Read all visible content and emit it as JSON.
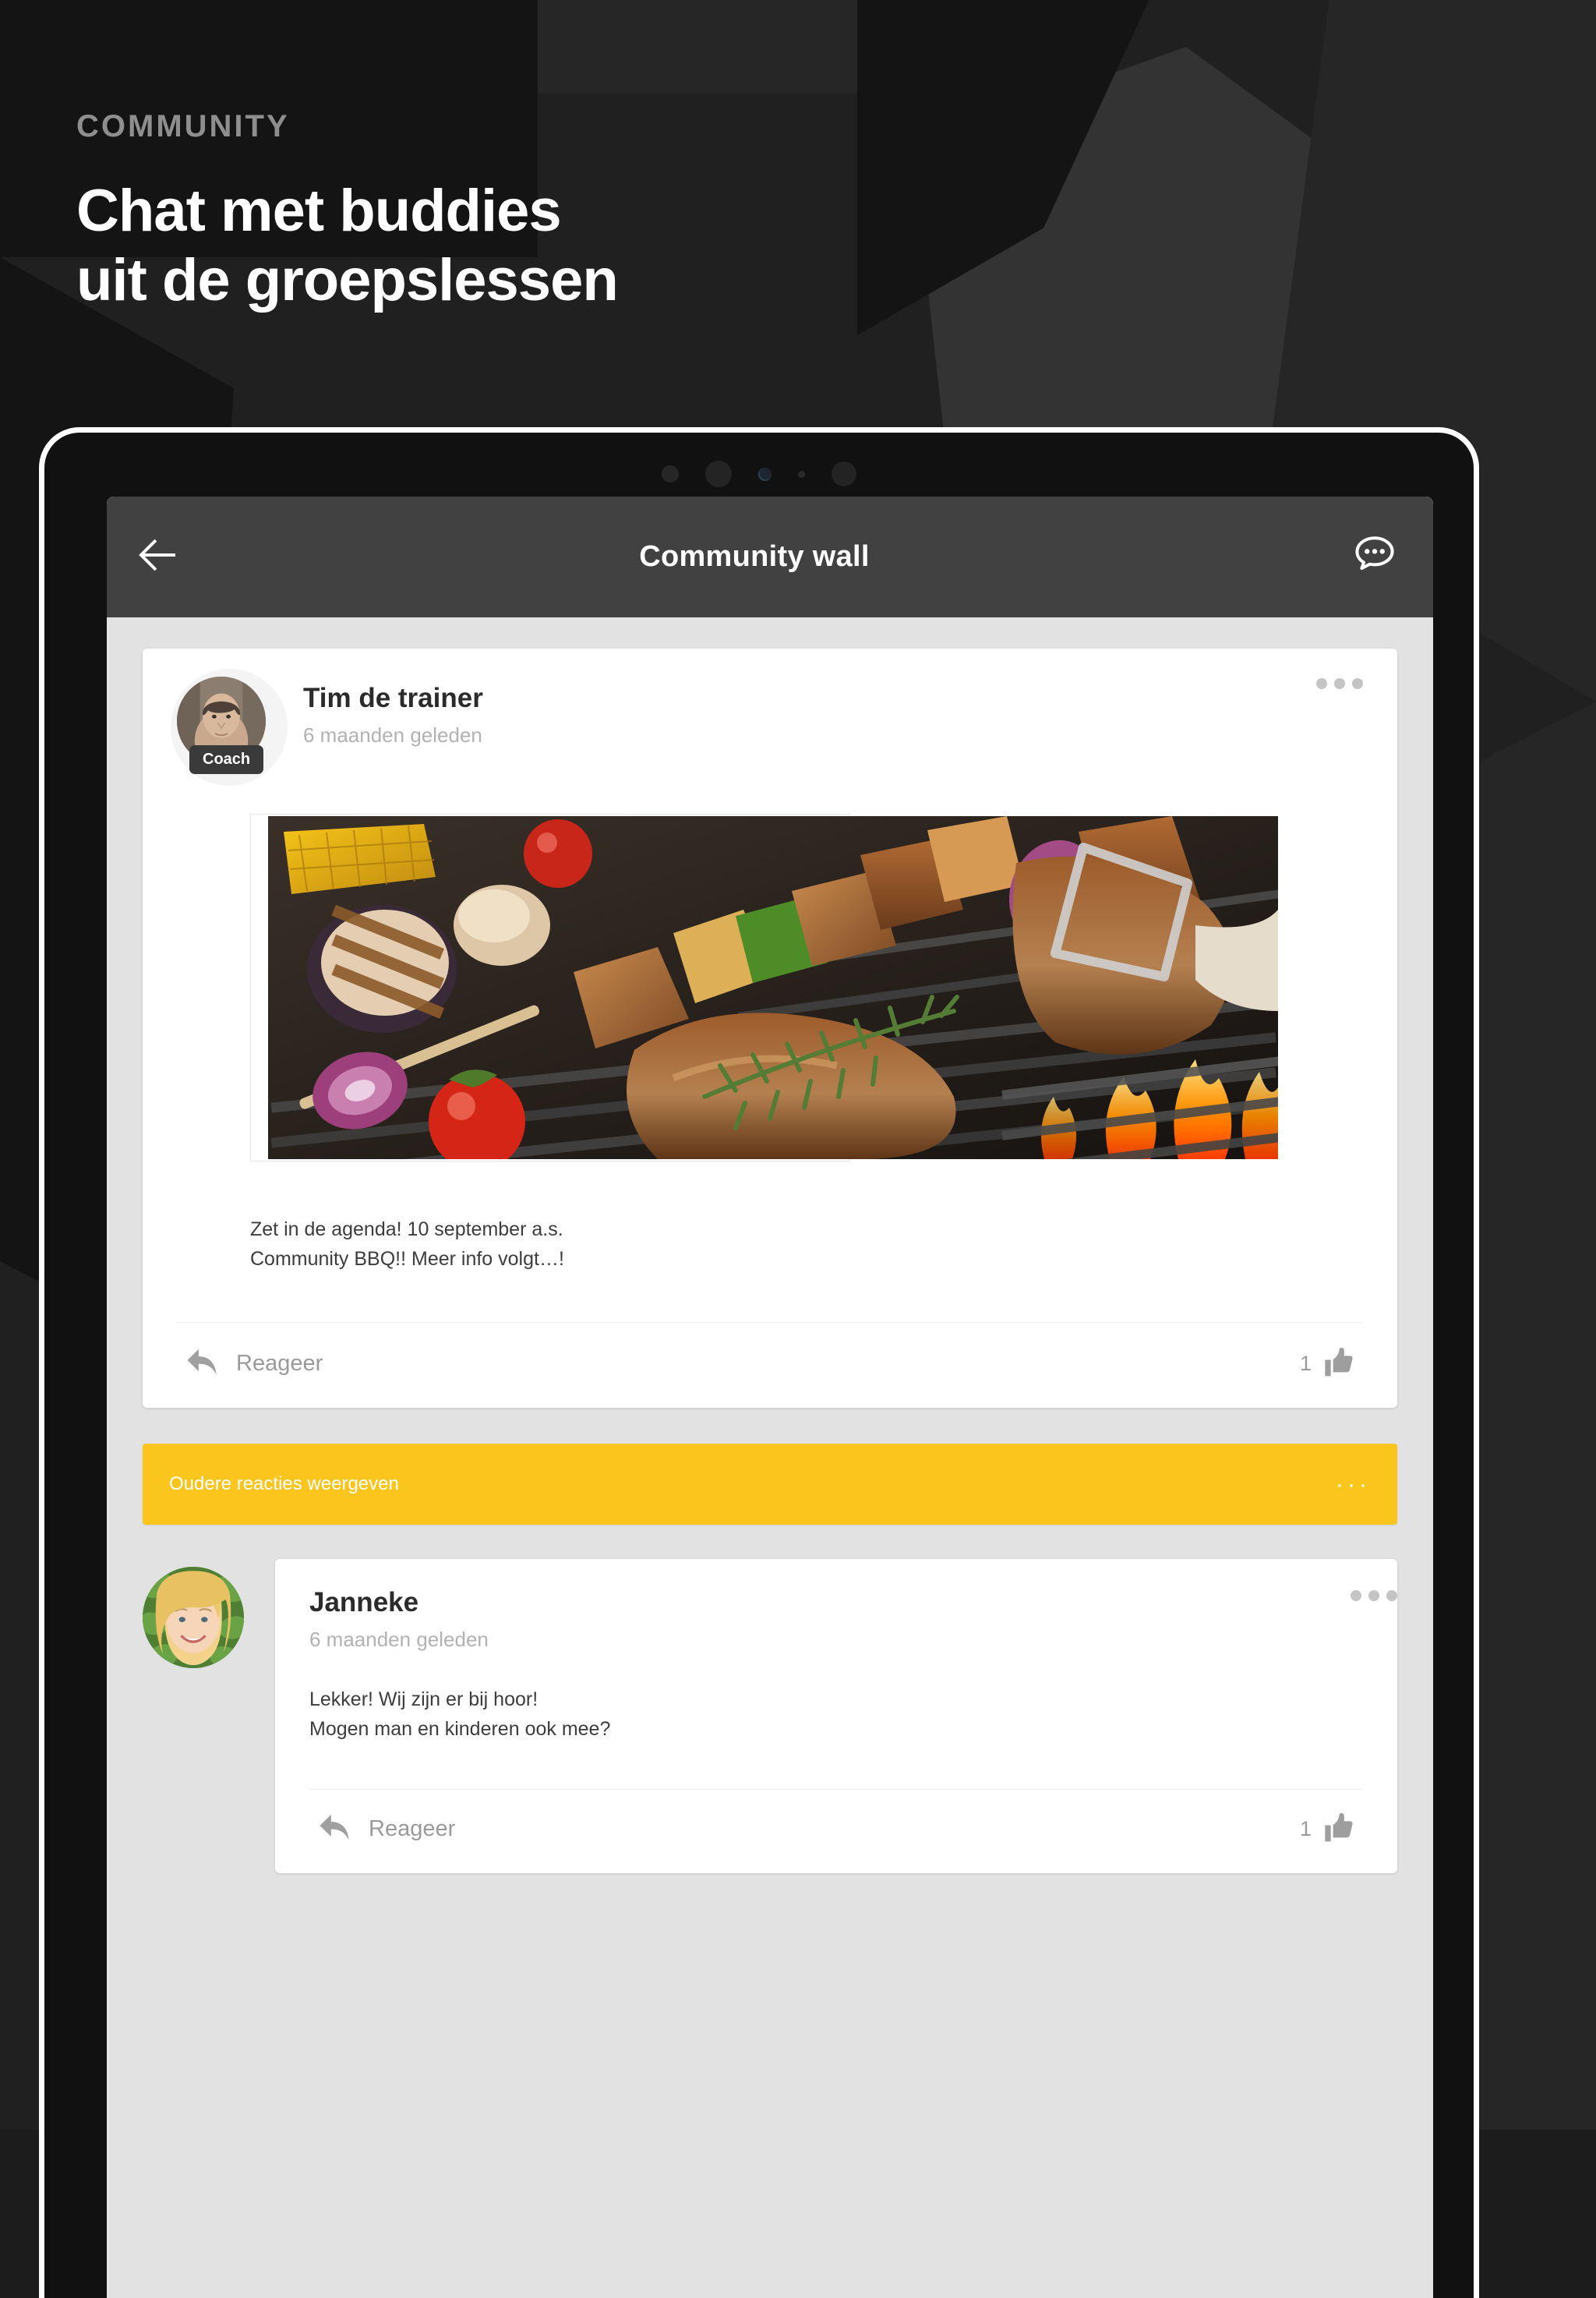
{
  "promo": {
    "eyebrow": "COMMUNITY",
    "headline_line1": "Chat met buddies",
    "headline_line2": "uit de groepslessen"
  },
  "colors": {
    "accent_yellow": "#fac51c",
    "appbar": "#414141",
    "screen_bg": "#e2e2e2",
    "card": "#ffffff",
    "muted_text": "#b2b2b2"
  },
  "appbar": {
    "title": "Community wall",
    "back_icon": "arrow-left-icon",
    "chat_icon": "chat-bubble-icon"
  },
  "post": {
    "author": "Tim de trainer",
    "badge": "Coach",
    "time": "6 maanden geleden",
    "body_line1": "Zet in de agenda! 10 september a.s.",
    "body_line2": "Community BBQ!! Meer info volgt…!",
    "image_alt": "grilled-bbq-photo",
    "reply_label": "Reageer",
    "like_count": "1",
    "menu_icon": "overflow-dots-icon",
    "reply_icon": "reply-arrow-icon",
    "like_icon": "thumbs-up-icon"
  },
  "older_banner": {
    "label": "Oudere reacties weergeven",
    "dots": "···"
  },
  "comment": {
    "author": "Janneke",
    "time": "6 maanden geleden",
    "body_line1": "Lekker! Wij zijn er bij hoor!",
    "body_line2": "Mogen man en kinderen ook mee?",
    "reply_label": "Reageer",
    "like_count": "1",
    "menu_icon": "overflow-dots-icon",
    "reply_icon": "reply-arrow-icon",
    "like_icon": "thumbs-up-icon"
  }
}
